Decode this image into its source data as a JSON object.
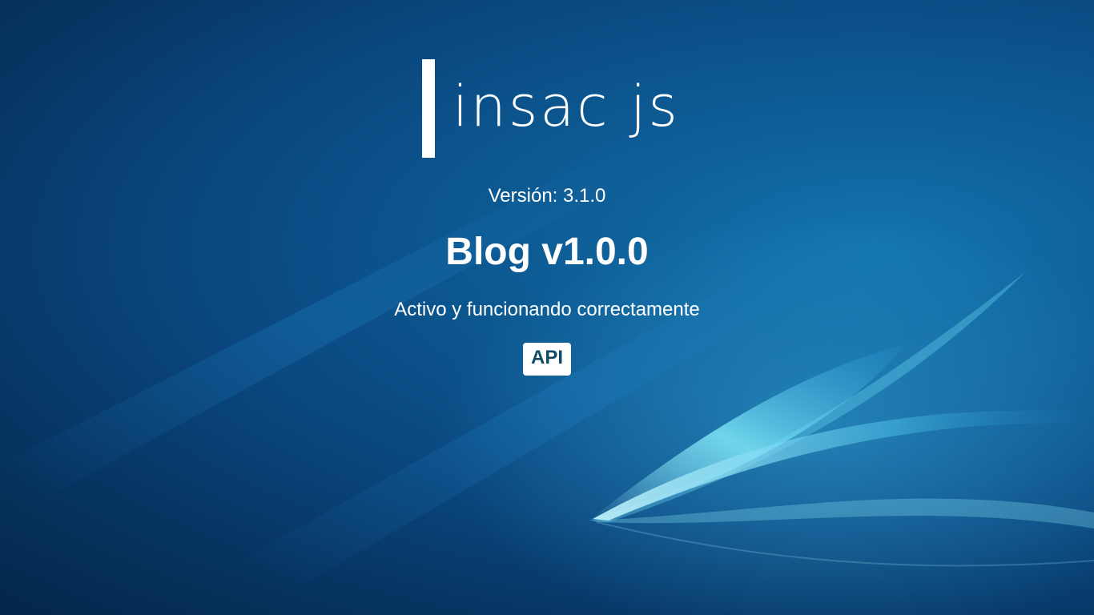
{
  "logo": {
    "text": "insac js",
    "bar_color": "#ffffff"
  },
  "version_text": "Versión: 3.1.0",
  "title": "Blog v1.0.0",
  "status_text": "Activo y funcionando correctamente",
  "api_button": {
    "label": "API",
    "background": "#ffffff",
    "text_color": "#0f4a66"
  },
  "colors": {
    "background_primary": "#0a477f",
    "background_dark": "#04264a",
    "glow": "#5fd8f0"
  }
}
